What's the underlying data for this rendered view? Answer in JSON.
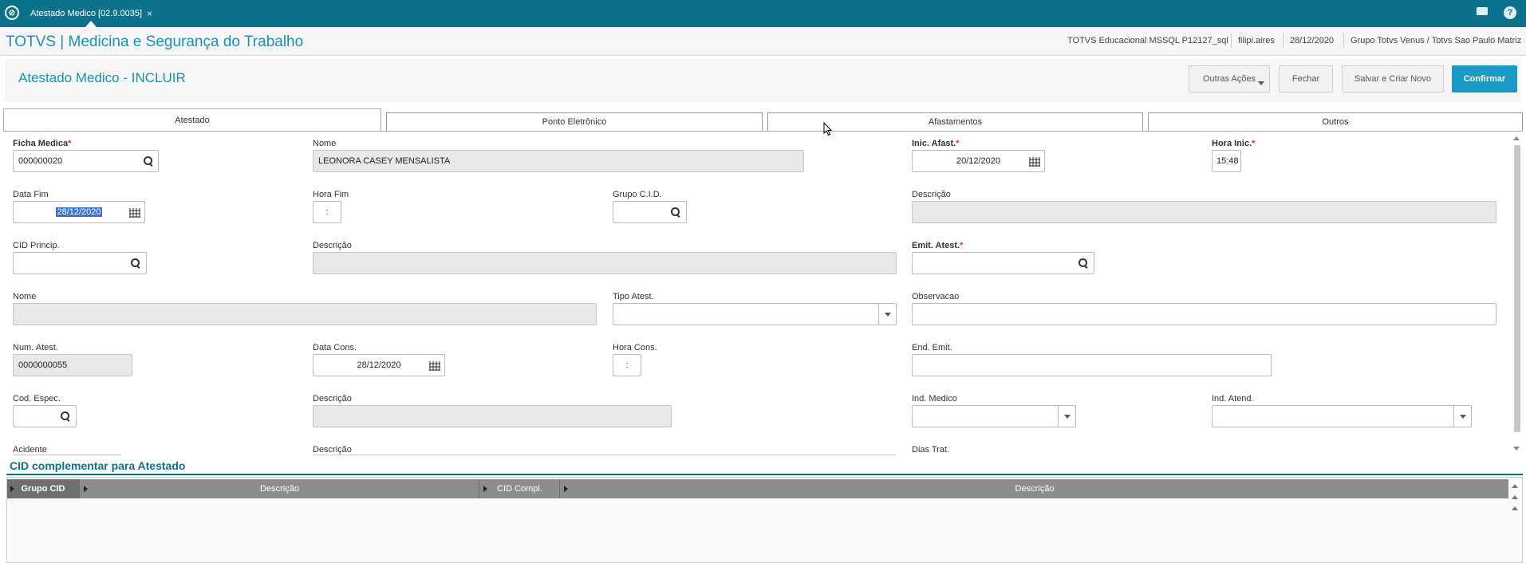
{
  "topbar": {
    "tab_title": "Atestado Medico [02.9.0035]",
    "close_glyph": "×",
    "help_glyph": "?"
  },
  "appbar": {
    "title": "TOTVS | Medicina e Segurança do Trabalho",
    "environment": "TOTVS Educacional MSSQL P12127_sql",
    "user": "filipi.aires",
    "date": "28/12/2020",
    "company": "Grupo Totvs Venus / Totvs Sao Paulo Matriz"
  },
  "form": {
    "title": "Atestado Medico - INCLUIR",
    "buttons": {
      "more_actions": "Outras Ações",
      "close": "Fechar",
      "save_new": "Salvar e Criar Novo",
      "confirm": "Confirmar"
    }
  },
  "tabs": [
    "Atestado",
    "Ponto Eletrônico",
    "Afastamentos",
    "Outros"
  ],
  "fields": {
    "ficha_medica": {
      "label": "Ficha Medica",
      "required": "*",
      "value": "000000020"
    },
    "nome": {
      "label": "Nome",
      "value": "LEONORA CASEY MENSALISTA"
    },
    "inic_afast": {
      "label": "Inic. Afast.",
      "required": "*",
      "value": "20/12/2020"
    },
    "hora_inic": {
      "label": "Hora Inic.",
      "required": "*",
      "value": "15:48"
    },
    "data_fim": {
      "label": "Data Fim",
      "value": "28/12/2020"
    },
    "hora_fim": {
      "label": "Hora Fim",
      "value": ":"
    },
    "grupo_cid": {
      "label": "Grupo C.I.D.",
      "value": ""
    },
    "descricao1": {
      "label": "Descrição",
      "value": ""
    },
    "cid_princip": {
      "label": "CID Princip.",
      "value": ""
    },
    "descricao2": {
      "label": "Descrição",
      "value": ""
    },
    "emit_atest": {
      "label": "Emit. Atest.",
      "required": "*",
      "value": ""
    },
    "nome2": {
      "label": "Nome",
      "value": ""
    },
    "tipo_atest": {
      "label": "Tipo Atest.",
      "value": ""
    },
    "observacao": {
      "label": "Observacao",
      "value": ""
    },
    "num_atest": {
      "label": "Num. Atest.",
      "value": "0000000055"
    },
    "data_cons": {
      "label": "Data Cons.",
      "value": "28/12/2020"
    },
    "hora_cons": {
      "label": "Hora Cons.",
      "value": ":"
    },
    "end_emit": {
      "label": "End. Emit.",
      "value": ""
    },
    "cod_espec": {
      "label": "Cod. Espec.",
      "value": ""
    },
    "descricao3": {
      "label": "Descrição",
      "value": ""
    },
    "ind_medico": {
      "label": "Ind. Medico",
      "value": ""
    },
    "ind_atend": {
      "label": "Ind. Atend.",
      "value": ""
    },
    "acidente": {
      "label": "Acidente"
    },
    "descricao4": {
      "label": "Descrição"
    },
    "dias_trat": {
      "label": "Dias Trat."
    }
  },
  "grid": {
    "title": "CID complementar para Atestado",
    "columns": [
      "Grupo CID",
      "Descrição",
      "CID Compl.",
      "Descrição"
    ]
  }
}
